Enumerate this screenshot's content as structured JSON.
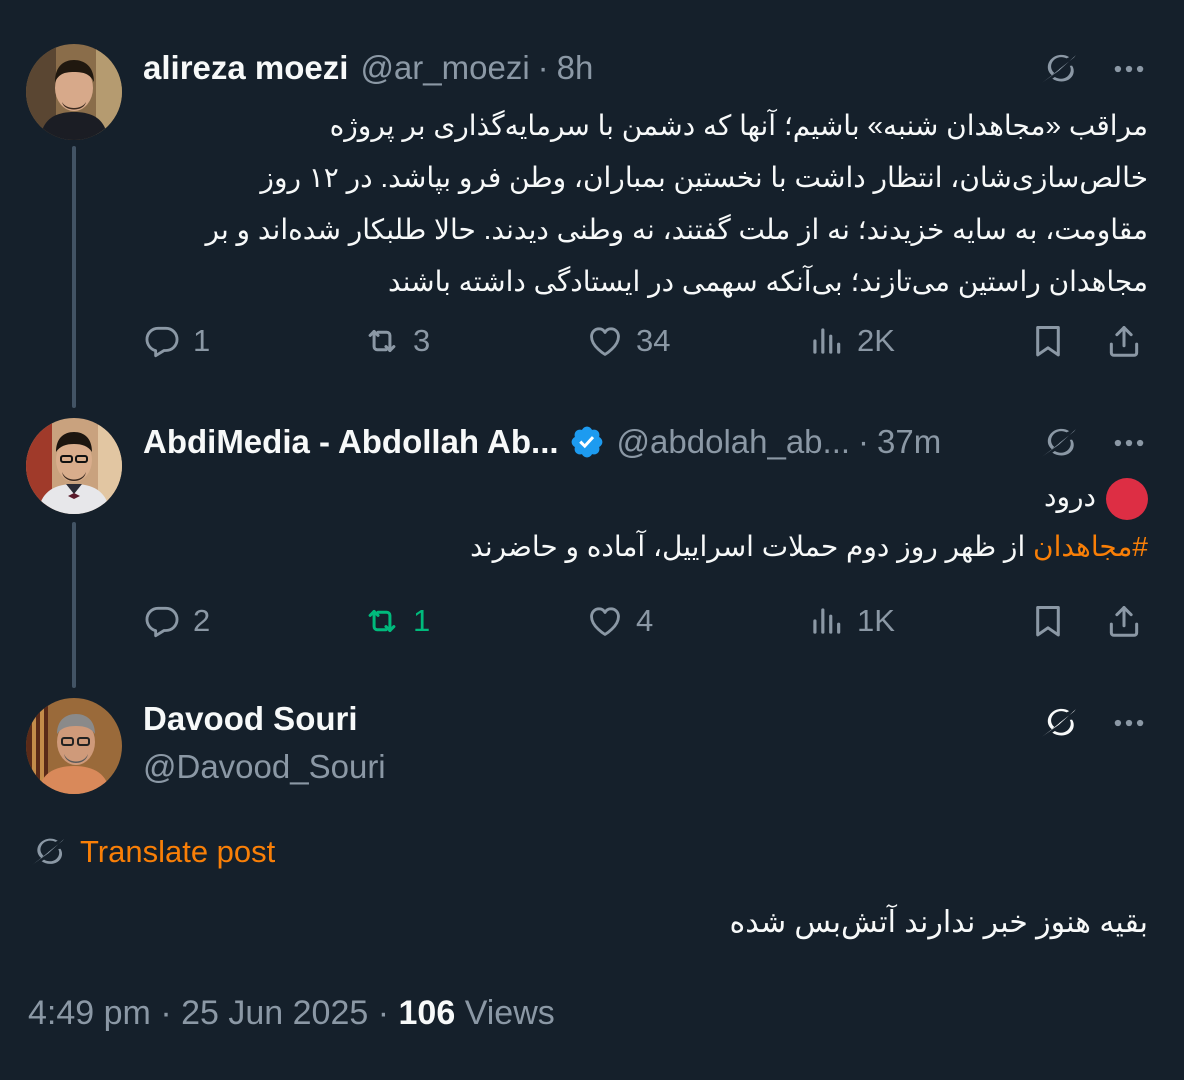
{
  "tweets": [
    {
      "name": "alireza moezi",
      "handle": "@ar_moezi",
      "dot": "·",
      "time": "8h",
      "text_lines": [
        "مراقب «مجاهدان شنبه» باشیم؛ آنها که دشمن با سرمایه‌گذاری بر پروژه",
        "خالص‌سازی‌شان، انتظار داشت با نخستین بمباران، وطن فرو بپاشد. در ۱۲ روز",
        "مقاومت، به سایه خزیدند؛ نه از ملت گفتند، نه وطنی دیدند. حالا طلبکار شده‌اند و بر",
        "مجاهدان راستین می‌تازند؛ بی‌آنکه سهمی در ایستادگی داشته باشند"
      ],
      "replies": "1",
      "retweets": "3",
      "likes": "34",
      "views": "2K"
    },
    {
      "name": "AbdiMedia - Abdollah Ab...",
      "handle": "@abdolah_ab...",
      "dot": "·",
      "time": "37m",
      "greeting": "درود",
      "hashtag": "#مجاهدان",
      "text_rest": " از ظهر روز دوم حملات اسراییل، آماده و حاضرند",
      "replies": "2",
      "retweets": "1",
      "likes": "4",
      "views": "1K"
    }
  ],
  "main": {
    "name": "Davood Souri",
    "handle": "@Davood_Souri",
    "translate_label": "Translate post",
    "text": "بقیه هنوز خبر ندارند آتش‌بس شده",
    "time": "4:49 pm",
    "sep": "·",
    "date": "25 Jun 2025",
    "views_count": "106",
    "views_label": "Views"
  },
  "colors": {
    "background": "#15202b",
    "text": "#f7f9f9",
    "muted": "#8b98a5",
    "accent": "#f97f07",
    "retweet_active": "#00ba7c",
    "verified": "#1d9bf0",
    "red_circle": "#dd2e44"
  },
  "icons": [
    "grok-icon",
    "more-icon",
    "reply-icon",
    "retweet-icon",
    "like-icon",
    "views-icon",
    "bookmark-icon",
    "share-icon",
    "verified-badge-icon",
    "red-circle-emoji"
  ]
}
